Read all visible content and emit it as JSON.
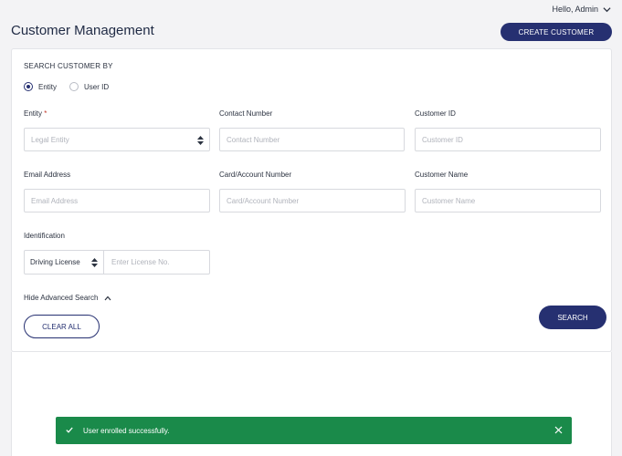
{
  "header": {
    "greeting": "Hello, Admin",
    "page_title": "Customer Management",
    "create_button": "CREATE CUSTOMER"
  },
  "search": {
    "section_label": "SEARCH CUSTOMER BY",
    "radio_options": [
      {
        "label": "Entity",
        "checked": true
      },
      {
        "label": "User ID",
        "checked": false
      }
    ],
    "fields": {
      "entity": {
        "label": "Entity",
        "required_mark": "*",
        "placeholder": "Legal Entity"
      },
      "contact_number": {
        "label": "Contact Number",
        "placeholder": "Contact Number"
      },
      "customer_id": {
        "label": "Customer ID",
        "placeholder": "Customer ID"
      },
      "email": {
        "label": "Email Address",
        "placeholder": "Email Address"
      },
      "card_account": {
        "label": "Card/Account Number",
        "placeholder": "Card/Account Number"
      },
      "customer_name": {
        "label": "Customer Name",
        "placeholder": "Customer Name"
      },
      "identification": {
        "label": "Identification",
        "type_value": "Driving License",
        "number_placeholder": "Enter License No."
      }
    },
    "advanced_toggle": "Hide Advanced Search",
    "clear_button": "CLEAR ALL",
    "search_button": "SEARCH"
  },
  "toast": {
    "message": "User enrolled successfully.",
    "color": "#1a8a4a"
  },
  "colors": {
    "primary": "#263071",
    "background": "#f3f3f5"
  }
}
